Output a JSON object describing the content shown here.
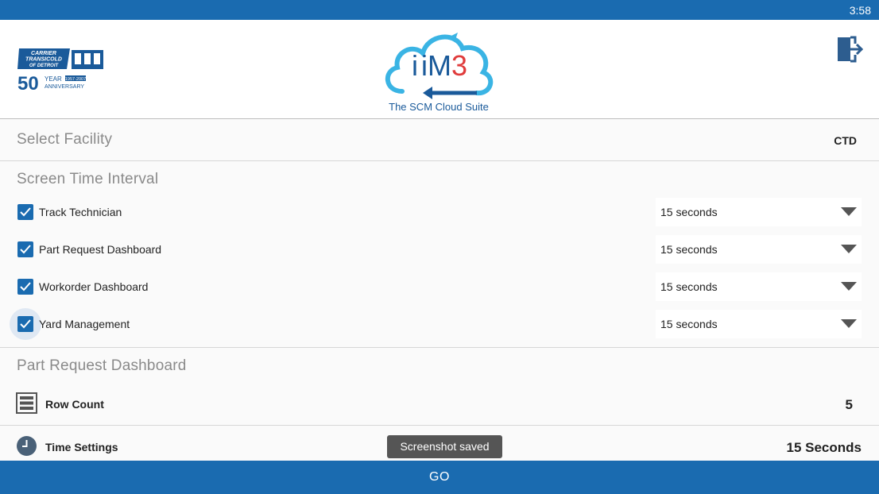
{
  "status_bar": {
    "time": "3:58"
  },
  "header": {
    "brand_logo": {
      "line1": "CARRIER",
      "line2": "TRANSICOLD",
      "line3": "OF DETROIT",
      "years": "50",
      "year_word": "YEAR",
      "anniv": "ANNIVERSARY",
      "dates": "1957-2007"
    },
    "product_logo": {
      "name_prefix": "iM",
      "name_suffix": "3",
      "tagline": "The SCM Cloud Suite"
    },
    "logout_icon": "exit-door-icon"
  },
  "facility": {
    "label": "Select Facility",
    "value": "CTD"
  },
  "screen_time": {
    "title": "Screen Time Interval",
    "items": [
      {
        "label": "Track Technician",
        "checked": true,
        "interval": "15 seconds"
      },
      {
        "label": "Part Request Dashboard",
        "checked": true,
        "interval": "15 seconds"
      },
      {
        "label": "Workorder Dashboard",
        "checked": true,
        "interval": "15 seconds"
      },
      {
        "label": "Yard Management",
        "checked": true,
        "interval": "15 seconds"
      }
    ]
  },
  "part_request": {
    "title": "Part Request Dashboard",
    "row_count": {
      "label": "Row Count",
      "value": "5",
      "icon": "list-icon"
    },
    "time_settings": {
      "label": "Time Settings",
      "value": "15 Seconds",
      "icon": "clock-icon"
    }
  },
  "toast": "Screenshot saved",
  "footer": {
    "go_label": "GO"
  },
  "colors": {
    "primary": "#1a6bb0",
    "accent_red": "#e03b3b",
    "section_gray": "#8a8a8a"
  }
}
